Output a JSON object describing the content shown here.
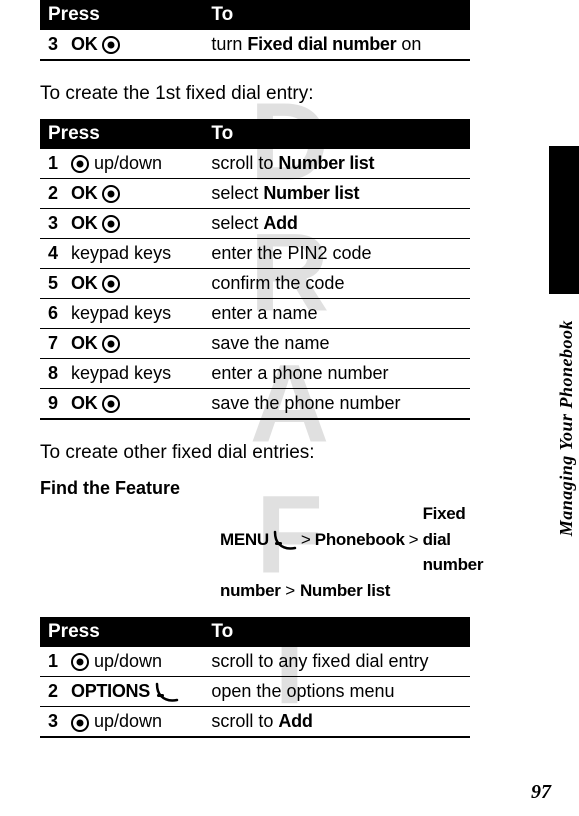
{
  "watermark": "DRAFT",
  "sectionLabel": "Managing Your Phonebook",
  "pageNumber": "97",
  "table1": {
    "headers": {
      "press": "Press",
      "to": "To"
    },
    "rows": [
      {
        "num": "3",
        "label": "OK",
        "icon": "center-key-icon",
        "action_pre": "turn ",
        "action_bold": "Fixed dial number",
        "action_post": " on"
      }
    ]
  },
  "intro2": "To create the 1st fixed dial entry:",
  "table2": {
    "headers": {
      "press": "Press",
      "to": "To"
    },
    "rows": [
      {
        "num": "1",
        "label": "up/down",
        "icon": "nav-key-icon",
        "iconFirst": true,
        "action_pre": "scroll to ",
        "action_bold": "Number list",
        "action_post": ""
      },
      {
        "num": "2",
        "label": "OK",
        "icon": "center-key-icon",
        "action_pre": "select ",
        "action_bold": "Number list",
        "action_post": ""
      },
      {
        "num": "3",
        "label": "OK",
        "icon": "center-key-icon",
        "action_pre": "select ",
        "action_bold": "Add",
        "action_post": ""
      },
      {
        "num": "4",
        "label": "keypad keys",
        "icon": null,
        "action_pre": "enter the PIN2 code",
        "action_bold": "",
        "action_post": ""
      },
      {
        "num": "5",
        "label": "OK",
        "icon": "center-key-icon",
        "action_pre": "confirm the code",
        "action_bold": "",
        "action_post": ""
      },
      {
        "num": "6",
        "label": "keypad keys",
        "icon": null,
        "action_pre": "enter a name",
        "action_bold": "",
        "action_post": ""
      },
      {
        "num": "7",
        "label": "OK",
        "icon": "center-key-icon",
        "action_pre": "save the name",
        "action_bold": "",
        "action_post": ""
      },
      {
        "num": "8",
        "label": "keypad keys",
        "icon": null,
        "action_pre": "enter a phone number",
        "action_bold": "",
        "action_post": ""
      },
      {
        "num": "9",
        "label": "OK",
        "icon": "center-key-icon",
        "action_pre": "save the phone number",
        "action_bold": "",
        "action_post": ""
      }
    ]
  },
  "intro3": "To create other fixed dial entries:",
  "findFeature": {
    "heading": "Find the Feature",
    "menuLabel": "MENU",
    "sep": ">",
    "parts": [
      "Phonebook",
      "Fixed dial number",
      "Number list"
    ]
  },
  "table3": {
    "headers": {
      "press": "Press",
      "to": "To"
    },
    "rows": [
      {
        "num": "1",
        "label": "up/down",
        "icon": "nav-key-icon",
        "iconFirst": true,
        "action_pre": "scroll to any fixed dial entry",
        "action_bold": "",
        "action_post": ""
      },
      {
        "num": "2",
        "label": "OPTIONS",
        "icon": "softkey-icon",
        "action_pre": "open the options menu",
        "action_bold": "",
        "action_post": ""
      },
      {
        "num": "3",
        "label": "up/down",
        "icon": "nav-key-icon",
        "iconFirst": true,
        "action_pre": "scroll to ",
        "action_bold": "Add",
        "action_post": ""
      }
    ]
  }
}
